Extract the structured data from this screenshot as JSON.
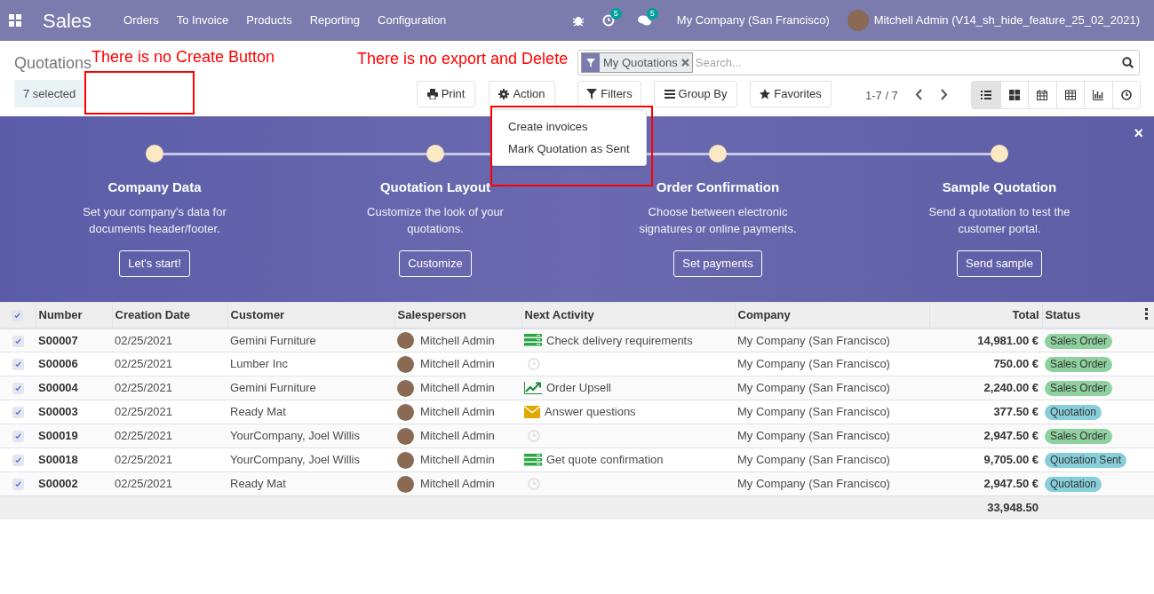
{
  "navbar": {
    "app": "Sales",
    "menus": [
      "Orders",
      "To Invoice",
      "Products",
      "Reporting",
      "Configuration"
    ],
    "activity_count": "5",
    "message_count": "5",
    "company": "My Company (San Francisco)",
    "user": "Mitchell Admin (V14_sh_hide_feature_25_02_2021)"
  },
  "control_panel": {
    "title": "Quotations",
    "selected_count": "7 selected",
    "print": "Print",
    "action": "Action",
    "filter_facet": "My Quotations",
    "search_placeholder": "Search...",
    "filters": "Filters",
    "group_by": "Group By",
    "favorites": "Favorites",
    "pager": "1-7 / 7",
    "views": [
      {
        "kind": "list",
        "selected": true
      },
      {
        "kind": "kanban",
        "selected": false
      },
      {
        "kind": "calendar",
        "selected": false
      },
      {
        "kind": "pivot",
        "selected": false
      },
      {
        "kind": "graph",
        "selected": false
      },
      {
        "kind": "activity",
        "selected": false
      }
    ]
  },
  "action_menu": [
    "Create invoices",
    "Mark Quotation as Sent"
  ],
  "annotations": [
    {
      "text": "There is no Create Button",
      "kind": "box"
    },
    {
      "text": "There is no export and Delete",
      "kind": "menu"
    }
  ],
  "banner": {
    "steps": [
      {
        "title": "Company Data",
        "text": "Set your company's data for documents header/footer.",
        "button": "Let's start!"
      },
      {
        "title": "Quotation Layout",
        "text": "Customize the look of your quotations.",
        "button": "Customize"
      },
      {
        "title": "Order Confirmation",
        "text": "Choose between electronic signatures or online payments.",
        "button": "Set payments"
      },
      {
        "title": "Sample Quotation",
        "text": "Send a quotation to test the customer portal.",
        "button": "Send sample"
      }
    ],
    "close": "×"
  },
  "table": {
    "all_checked": true,
    "columns": [
      "Number",
      "Creation Date",
      "Customer",
      "Salesperson",
      "Next Activity",
      "Company",
      "Total",
      "Status"
    ],
    "rows": [
      {
        "checked": true,
        "number": "S00007",
        "date": "02/25/2021",
        "customer": "Gemini Furniture",
        "salesperson": "Mitchell Admin",
        "activity": {
          "kind": "todo",
          "text": "Check delivery requirements"
        },
        "company": "My Company (San Francisco)",
        "total": "14,981.00 €",
        "status": "Sales Order",
        "color": "#8fd19e"
      },
      {
        "checked": true,
        "number": "S00006",
        "date": "02/25/2021",
        "customer": "Lumber Inc",
        "salesperson": "Mitchell Admin",
        "activity": {
          "kind": "none"
        },
        "company": "My Company (San Francisco)",
        "total": "750.00 €",
        "status": "Sales Order",
        "color": "#8fd19e"
      },
      {
        "checked": true,
        "number": "S00004",
        "date": "02/25/2021",
        "customer": "Gemini Furniture",
        "salesperson": "Mitchell Admin",
        "activity": {
          "kind": "upsell",
          "text": "Order Upsell"
        },
        "company": "My Company (San Francisco)",
        "total": "2,240.00 €",
        "status": "Sales Order",
        "color": "#8fd19e"
      },
      {
        "checked": true,
        "number": "S00003",
        "date": "02/25/2021",
        "customer": "Ready Mat",
        "salesperson": "Mitchell Admin",
        "activity": {
          "kind": "email",
          "text": "Answer questions"
        },
        "company": "My Company (San Francisco)",
        "total": "377.50 €",
        "status": "Quotation",
        "color": "#86cfda"
      },
      {
        "checked": true,
        "number": "S00019",
        "date": "02/25/2021",
        "customer": "YourCompany, Joel Willis",
        "salesperson": "Mitchell Admin",
        "activity": {
          "kind": "none"
        },
        "company": "My Company (San Francisco)",
        "total": "2,947.50 €",
        "status": "Sales Order",
        "color": "#8fd19e"
      },
      {
        "checked": true,
        "number": "S00018",
        "date": "02/25/2021",
        "customer": "YourCompany, Joel Willis",
        "salesperson": "Mitchell Admin",
        "activity": {
          "kind": "todo",
          "text": "Get quote confirmation"
        },
        "company": "My Company (San Francisco)",
        "total": "9,705.00 €",
        "status": "Quotation Sent",
        "color": "#86cfda"
      },
      {
        "checked": true,
        "number": "S00002",
        "date": "02/25/2021",
        "customer": "Ready Mat",
        "salesperson": "Mitchell Admin",
        "activity": {
          "kind": "none"
        },
        "company": "My Company (San Francisco)",
        "total": "2,947.50 €",
        "status": "Quotation",
        "color": "#86cfda"
      }
    ],
    "sum": "33,948.50"
  }
}
